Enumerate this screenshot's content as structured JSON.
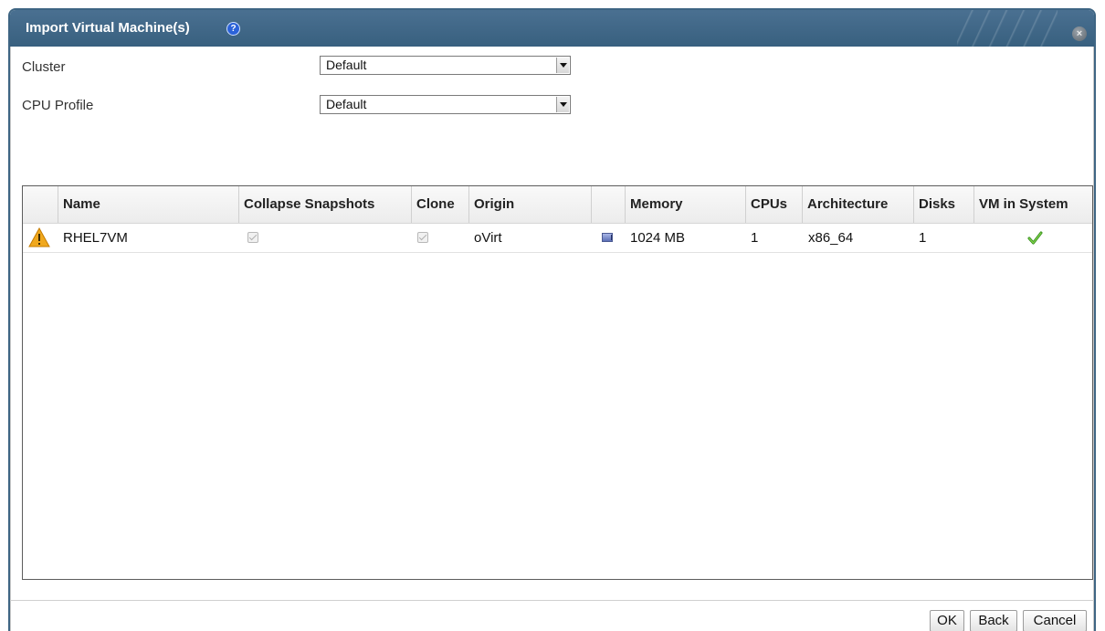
{
  "dialog": {
    "title": "Import Virtual Machine(s)",
    "help_icon": "question-circle-icon",
    "close_icon": "close-circle-icon",
    "header_color": "#3e6583"
  },
  "form": {
    "cluster_label": "Cluster",
    "cluster_value": "Default",
    "cpu_profile_label": "CPU Profile",
    "cpu_profile_value": "Default"
  },
  "table": {
    "columns": [
      "",
      "Name",
      "Collapse Snapshots",
      "Clone",
      "Origin",
      "",
      "Memory",
      "CPUs",
      "Architecture",
      "Disks",
      "VM in System"
    ],
    "rows": [
      {
        "status_icon": "warning-triangle-icon",
        "name": "RHEL7VM",
        "collapse_snapshots": true,
        "clone": true,
        "origin": "oVirt",
        "type_icon": "monitor-icon",
        "memory": "1024 MB",
        "cpus": "1",
        "architecture": "x86_64",
        "disks": "1",
        "vm_in_system_icon": "green-check-icon"
      }
    ]
  },
  "buttons": {
    "ok": "OK",
    "back": "Back",
    "cancel": "Cancel"
  }
}
